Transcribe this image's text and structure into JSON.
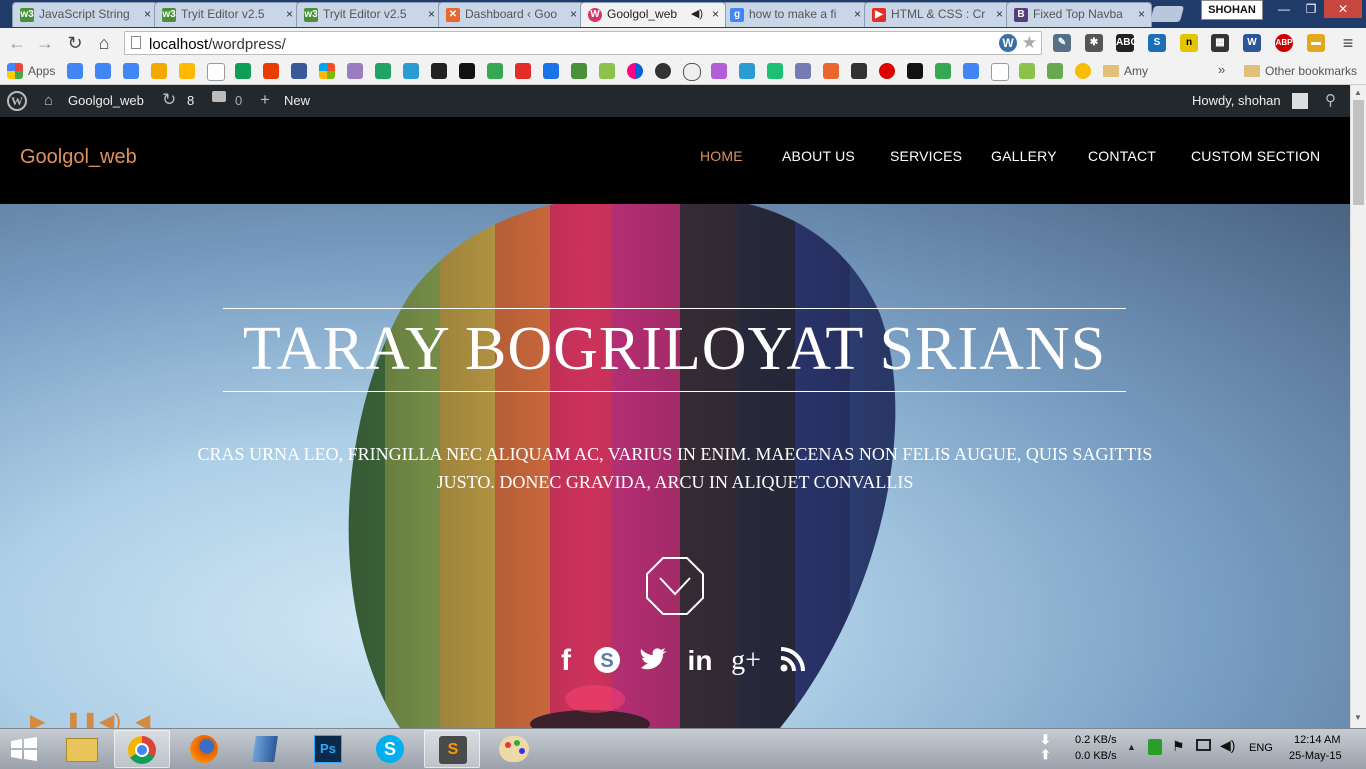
{
  "browser": {
    "tabs": [
      {
        "title": "JavaScript String",
        "icon": "w3schools",
        "color": "#4a8f3a"
      },
      {
        "title": "Tryit Editor v2.5",
        "icon": "w3schools",
        "color": "#4a8f3a"
      },
      {
        "title": "Tryit Editor v2.5",
        "icon": "w3schools",
        "color": "#4a8f3a"
      },
      {
        "title": "Dashboard ‹ Goo",
        "icon": "xampp",
        "color": "#e9662c"
      },
      {
        "title": "Goolgol_web",
        "icon": "wordpress-pink",
        "color": "#d6336c"
      },
      {
        "title": "how to make a fi",
        "icon": "google",
        "color": "#4285f4"
      },
      {
        "title": "HTML & CSS : Cr",
        "icon": "youtube",
        "color": "#e52d27"
      },
      {
        "title": "Fixed Top Navba",
        "icon": "bootstrap",
        "color": "#563d7c"
      }
    ],
    "user_chip": "SHOHAN",
    "url": {
      "host": "localhost",
      "path": "/wordpress/"
    },
    "bookmarks": {
      "apps_label": "Apps",
      "folder_label": "Amy",
      "overflow": "»",
      "other_label": "Other bookmarks"
    }
  },
  "wp_admin": {
    "site_name": "Goolgol_web",
    "updates_count": "8",
    "comments_count": "0",
    "new_label": "New",
    "howdy": "Howdy, shohan"
  },
  "site": {
    "brand": "Goolgol_web",
    "menu": [
      "HOME",
      "ABOUT US",
      "SERVICES",
      "GALLERY",
      "CONTACT",
      "CUSTOM SECTION"
    ],
    "hero_title": "TARAY BOGRILOYAT SRIANS",
    "hero_text": "CRAS URNA LEO, FRINGILLA NEC ALIQUAM AC, VARIUS IN ENIM. MAECENAS NON FELIS AUGUE, QUIS SAGITTIS JUSTO. DONEC GRAVIDA, ARCU IN ALIQUET CONVALLIS",
    "social": [
      "facebook",
      "skype",
      "twitter",
      "linkedin",
      "google-plus",
      "rss"
    ]
  },
  "taskbar": {
    "net_down": "0.2 KB/s",
    "net_up": "0.0 KB/s",
    "lang": "ENG",
    "time": "12:14 AM",
    "date": "25-May-15"
  },
  "colors": {
    "accent": "#e0915a",
    "wp_bar": "#23282d",
    "header": "#000000"
  }
}
